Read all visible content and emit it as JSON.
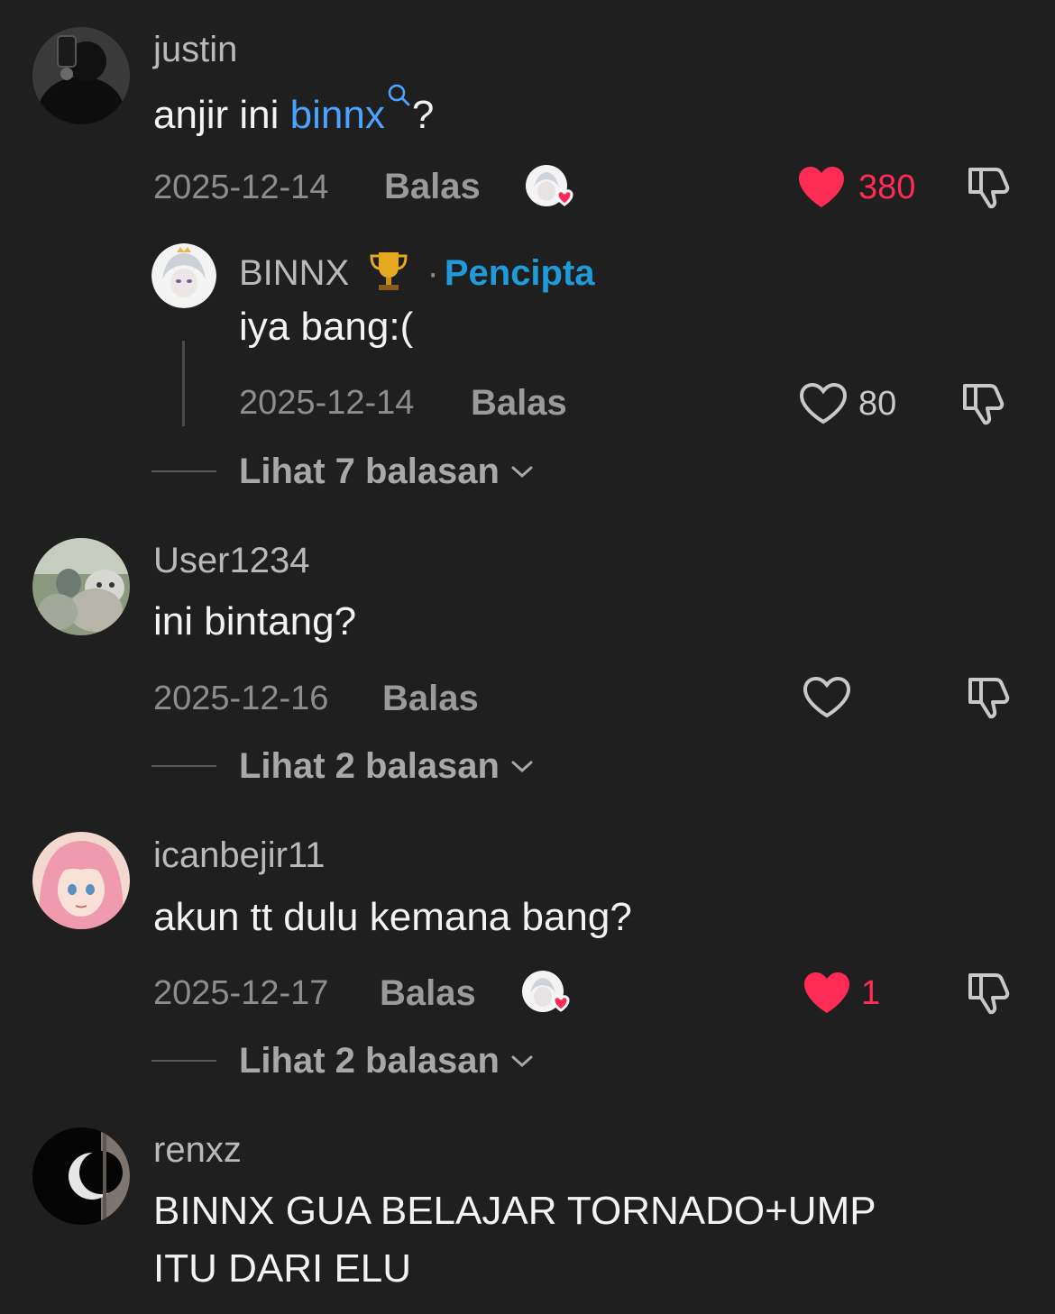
{
  "comments": [
    {
      "username": "justin",
      "text_before": "anjir ini ",
      "text_link": "binnx",
      "text_after": "?",
      "date": "2025-12-14",
      "reply_label": "Balas",
      "likes": "380",
      "liked": true,
      "replies": [
        {
          "username": "BINNX",
          "separator": "·",
          "creator_label": "Pencipta",
          "text": "iya bang:(",
          "date": "2025-12-14",
          "reply_label": "Balas",
          "likes": "80"
        }
      ],
      "view_replies": "Lihat 7 balasan"
    },
    {
      "username": "User1234",
      "text": "ini bintang?",
      "date": "2025-12-16",
      "reply_label": "Balas",
      "view_replies": "Lihat 2 balasan"
    },
    {
      "username": "icanbejir11",
      "text": "akun tt dulu kemana bang?",
      "date": "2025-12-17",
      "reply_label": "Balas",
      "likes": "1",
      "liked": true,
      "view_replies": "Lihat 2 balasan"
    },
    {
      "username": "renxz",
      "text_line1": "BINNX GUA BELAJAR TORNADO+UMP",
      "text_line2": "ITU DARI ELU"
    }
  ],
  "icons": {
    "search": "search-icon",
    "heart_filled": "heart-filled-icon",
    "heart_outline": "heart-outline-icon",
    "dislike": "thumbs-down-icon",
    "chevron": "chevron-down-icon",
    "trophy": "trophy-icon"
  },
  "colors": {
    "background": "#1f1f1f",
    "like_red": "#fe2c55",
    "link_blue": "#4aa3ff",
    "creator_blue": "#1e9bd8"
  }
}
